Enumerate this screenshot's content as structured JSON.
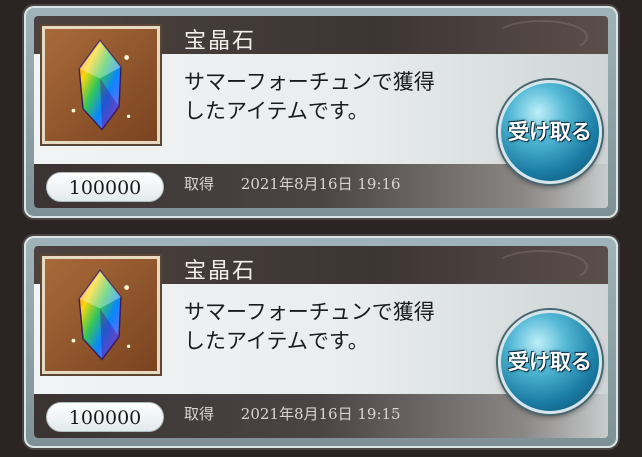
{
  "items": [
    {
      "name": "宝晶石",
      "description_line1": "サマーフォーチュンで獲得",
      "description_line2": "したアイテムです。",
      "count": "100000",
      "acquired_label": "取得",
      "acquired_time": "2021年8月16日 19:16",
      "receive_label": "受け取る",
      "icon": "rainbow-crystal-icon"
    },
    {
      "name": "宝晶石",
      "description_line1": "サマーフォーチュンで獲得",
      "description_line2": "したアイテムです。",
      "count": "100000",
      "acquired_label": "取得",
      "acquired_time": "2021年8月16日 19:15",
      "receive_label": "受け取る",
      "icon": "rainbow-crystal-icon"
    }
  ],
  "colors": {
    "title_bar": "#3d3532",
    "button_blue": "#1b7da4",
    "card_border": "#9fb3b9"
  }
}
